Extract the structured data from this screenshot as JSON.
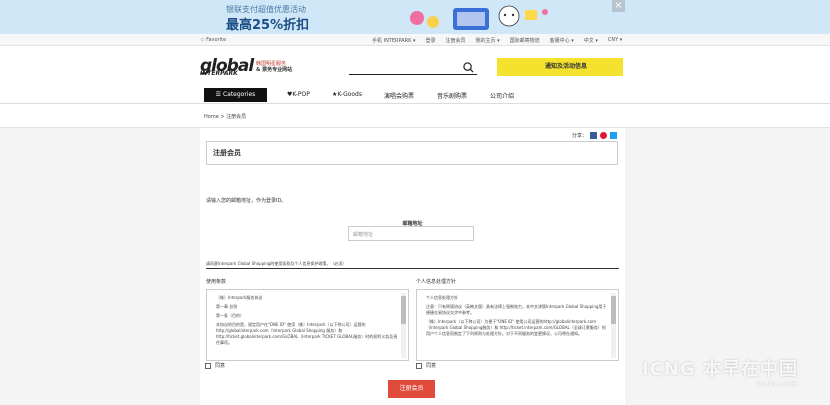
{
  "banner": {
    "line1": "银联支付超值优惠活动",
    "line2": "最高25%折扣",
    "close": "×"
  },
  "topbar": {
    "favorite": "☆ Favorite",
    "links": [
      "手机 INTERPARK ▾",
      "登录",
      "注册会员",
      "我的主页 ▾",
      "国际邮寄物流",
      "客服中心 ▾",
      "中文 ▾",
      "CNY ▾"
    ]
  },
  "header": {
    "logo": "global",
    "logo_small": "INTERPARK",
    "logo_sub1": "韩国明星服务",
    "logo_sub2": "& 票务专业网站",
    "search_placeholder": "",
    "promo": "通知及活动信息"
  },
  "nav": {
    "categories": "☰ Categories",
    "items": [
      "♥K-POP",
      "★K-Goods",
      "演唱会购票",
      "音乐剧购票",
      "公司介绍"
    ]
  },
  "breadcrumb": {
    "home": "Home",
    "sep": ">",
    "current": "注册会员"
  },
  "share": {
    "label": "分享："
  },
  "form": {
    "title": "注册会员",
    "instruction": "请输入您的邮箱地址，作为登录ID。",
    "email_label": "邮箱地址",
    "email_placeholder": "邮箱地址",
    "agree_all": "请同意Interpark Global Shopping的使用条款及个人信息保护政策。（必须）",
    "terms_title": "使用条款",
    "privacy_title": "个人信息处理方针",
    "terms_lines": [
      "（株）Interpark服务协议",
      "第一章 总则",
      "第一条（目的）",
      "本协议的目的是，规定用户在\"ONE ID\" 使用（株）Interpark（以下称公司）运营的http://globalinterpark.com（Interpark Global Shopping 服务）和 http://ticket.globalinterpark.com/GLOBAL（Interpark TICKET GLOBAL服务）时的权利义务及责任事项。"
    ],
    "privacy_lines": [
      "个人信息处理方针",
      "注意：只有原版协议（英韩文版）具有法律上强制效力，本中文译版Interpark Global Shopping用于便捷交易协议交涉中参考。",
      "（株）Interpark（以下称公司）为便于\"ONE ID\" 使用公司运营的http://globalinterpark.com（Interpark Global Shopping服务）和 http://ticket.interpark.com/GLOBAL（全球订票服务）的用户个人信息而制定了下列原则与处理方针。对于不同服务的变更情况，公司将在通知。"
    ],
    "agree_label": "同意",
    "submit": "注册会员"
  },
  "watermark": {
    "text": "ICNG 本早在中国",
    "small": "icnkr.com"
  }
}
